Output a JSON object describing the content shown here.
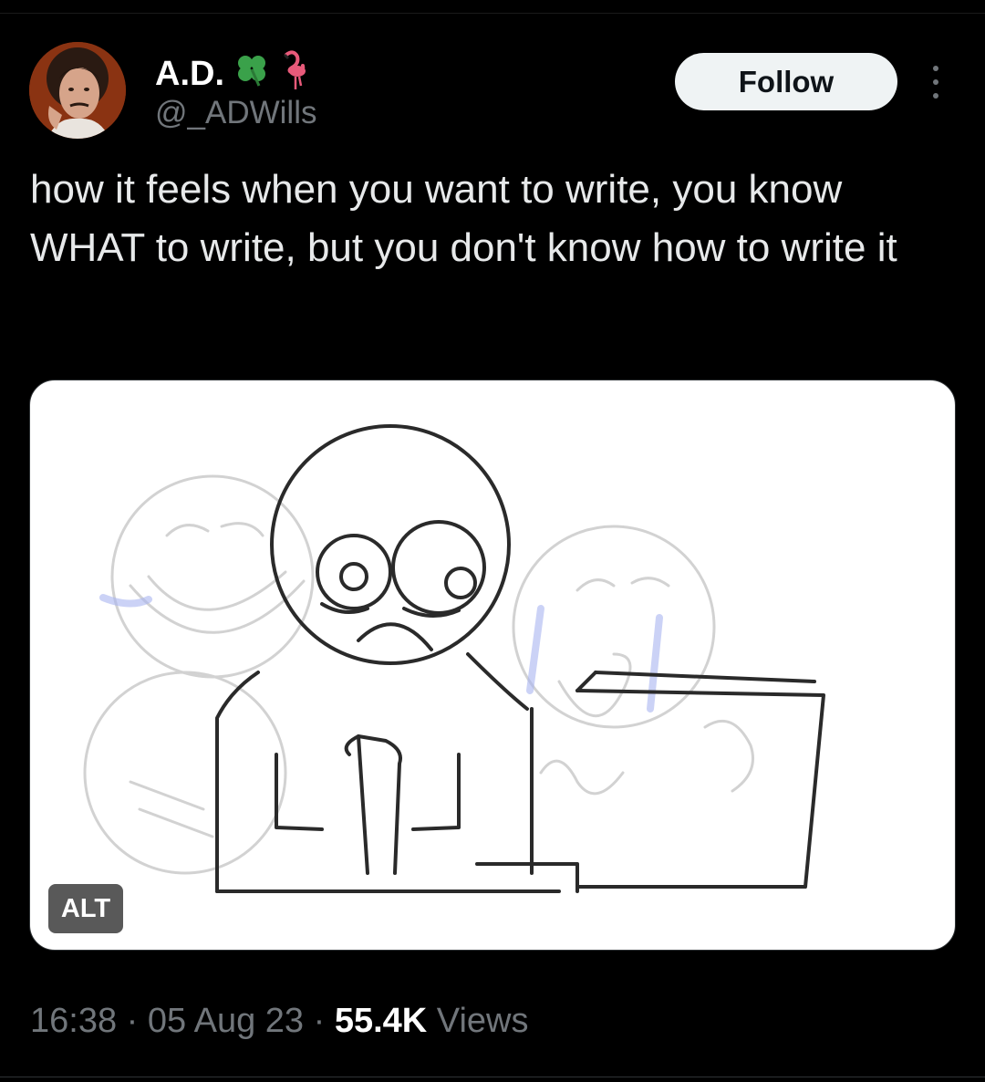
{
  "author": {
    "display_name": "A.D.",
    "handle": "@_ADWills",
    "name_emoji": [
      "clover-icon",
      "flamingo-icon"
    ],
    "avatar": "avatar-photo"
  },
  "actions": {
    "follow_label": "Follow",
    "more_icon": "more-vertical-icon"
  },
  "tweet": {
    "text": "how it feels when you want to write, you know WHAT to write, but you don't know how to write it"
  },
  "media": {
    "alt_label": "ALT",
    "content": "sketch-drawing"
  },
  "meta": {
    "time": "16:38",
    "separator": "·",
    "date": "05 Aug 23",
    "views_count": "55.4K",
    "views_label": "Views"
  },
  "colors": {
    "background": "#000000",
    "text": "#e7e9ea",
    "muted": "#71767b",
    "follow_bg": "#eff3f4",
    "clover": "#3aa14a",
    "flamingo": "#e85a7a"
  }
}
